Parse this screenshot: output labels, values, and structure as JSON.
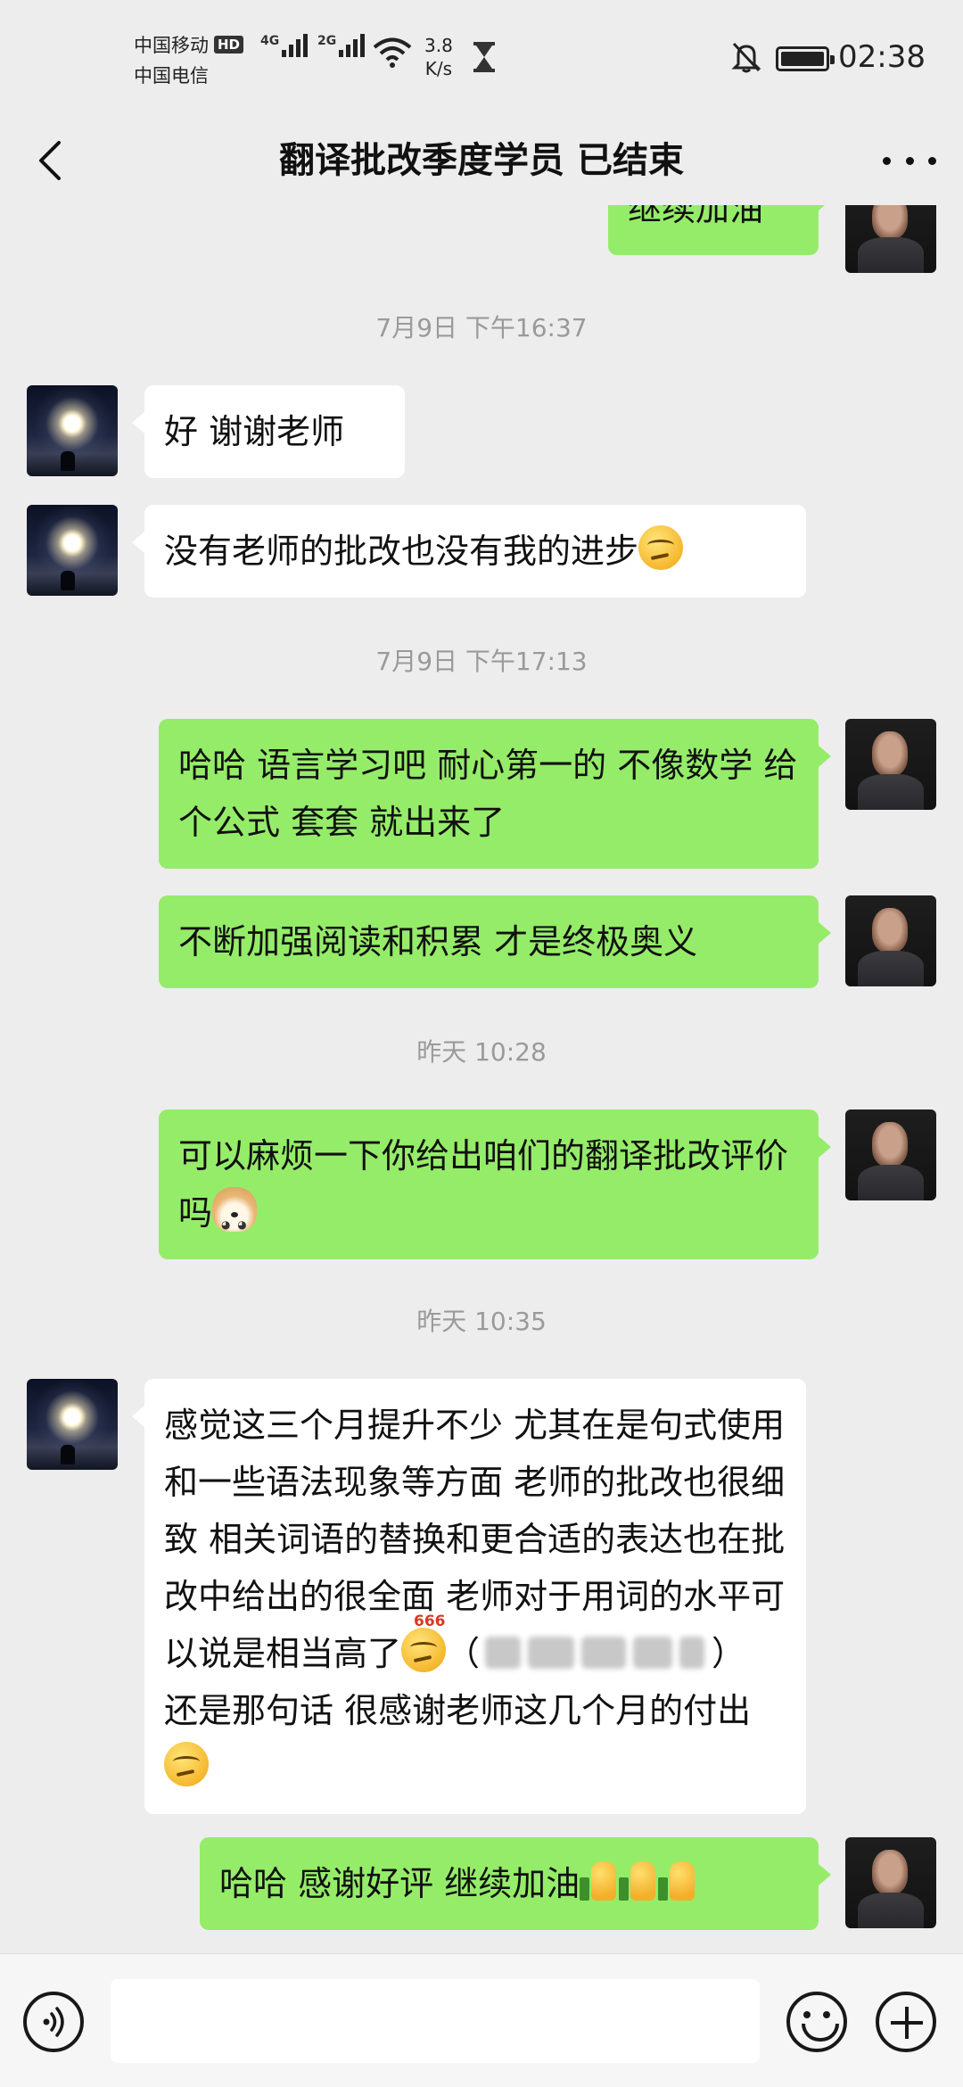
{
  "status_bar": {
    "carrier_1": "中国移动",
    "carrier_2": "中国电信",
    "hd_badge": "HD",
    "net_1": "4G",
    "net_2": "2G",
    "speed_value": "3.8",
    "speed_unit": "K/s",
    "time": "02:38",
    "battery_level": 1.0,
    "icons": [
      "wifi-icon",
      "hourglass-icon",
      "bell-off-icon",
      "battery-icon"
    ]
  },
  "header": {
    "title": "翻译批改季度学员 已结束",
    "back_icon": "chevron-left-icon",
    "more_icon": "more-icon"
  },
  "messages": [
    {
      "id": "m0",
      "sender": "teacher",
      "segments": [
        {
          "text": "继续加油"
        }
      ]
    },
    {
      "id": "t1",
      "type": "timestamp",
      "text": "7月9日 下午16:37"
    },
    {
      "id": "m1",
      "sender": "student",
      "segments": [
        {
          "text": "好 谢谢老师"
        }
      ]
    },
    {
      "id": "m2",
      "sender": "student",
      "segments": [
        {
          "text": "没有老师的批改也没有我的进步"
        },
        {
          "emoji": "smirk-emoji"
        }
      ]
    },
    {
      "id": "t2",
      "type": "timestamp",
      "text": "7月9日 下午17:13"
    },
    {
      "id": "m3",
      "sender": "teacher",
      "segments": [
        {
          "text": "哈哈 语言学习吧 耐心第一的 不像数学 给个公式 套套 就出来了"
        }
      ]
    },
    {
      "id": "m4",
      "sender": "teacher",
      "segments": [
        {
          "text": "不断加强阅读和积累 才是终极奥义"
        }
      ]
    },
    {
      "id": "t3",
      "type": "timestamp",
      "text": "昨天 10:28"
    },
    {
      "id": "m5",
      "sender": "teacher",
      "segments": [
        {
          "text": "可以麻烦一下你给出咱们的翻译批改评价吗"
        },
        {
          "emoji": "doge-emoji"
        }
      ]
    },
    {
      "id": "t4",
      "type": "timestamp",
      "text": "昨天 10:35"
    },
    {
      "id": "m6",
      "sender": "student",
      "segments": [
        {
          "text": "感觉这三个月提升不少 尤其在是句式使用和一些语法现象等方面 老师的批改也很细致 相关词语的替换和更合适的表达也在批改中给出的很全面 老师对于用词的水平可以说是相当高了"
        },
        {
          "emoji": "666-emoji",
          "label": "666"
        },
        {
          "text": "（"
        },
        {
          "blurred": "blurred-text"
        },
        {
          "text": "） 还是那句话 很感谢老师这几个月的付出"
        },
        {
          "emoji": "smirk-emoji"
        }
      ]
    },
    {
      "id": "m7",
      "sender": "teacher",
      "segments": [
        {
          "text": "哈哈 感谢好评 继续加油"
        },
        {
          "emoji": "thumbs-up-emoji"
        },
        {
          "emoji": "thumbs-up-emoji"
        },
        {
          "emoji": "thumbs-up-emoji"
        }
      ]
    }
  ],
  "input_bar": {
    "voice_icon": "voice-icon",
    "input_value": "",
    "input_placeholder": "",
    "emoji_icon": "emoji-icon",
    "add_icon": "plus-icon"
  },
  "colors": {
    "background": "#ededed",
    "self_bubble": "#95ec69",
    "other_bubble": "#ffffff",
    "timestamp": "#9a9a9a"
  }
}
